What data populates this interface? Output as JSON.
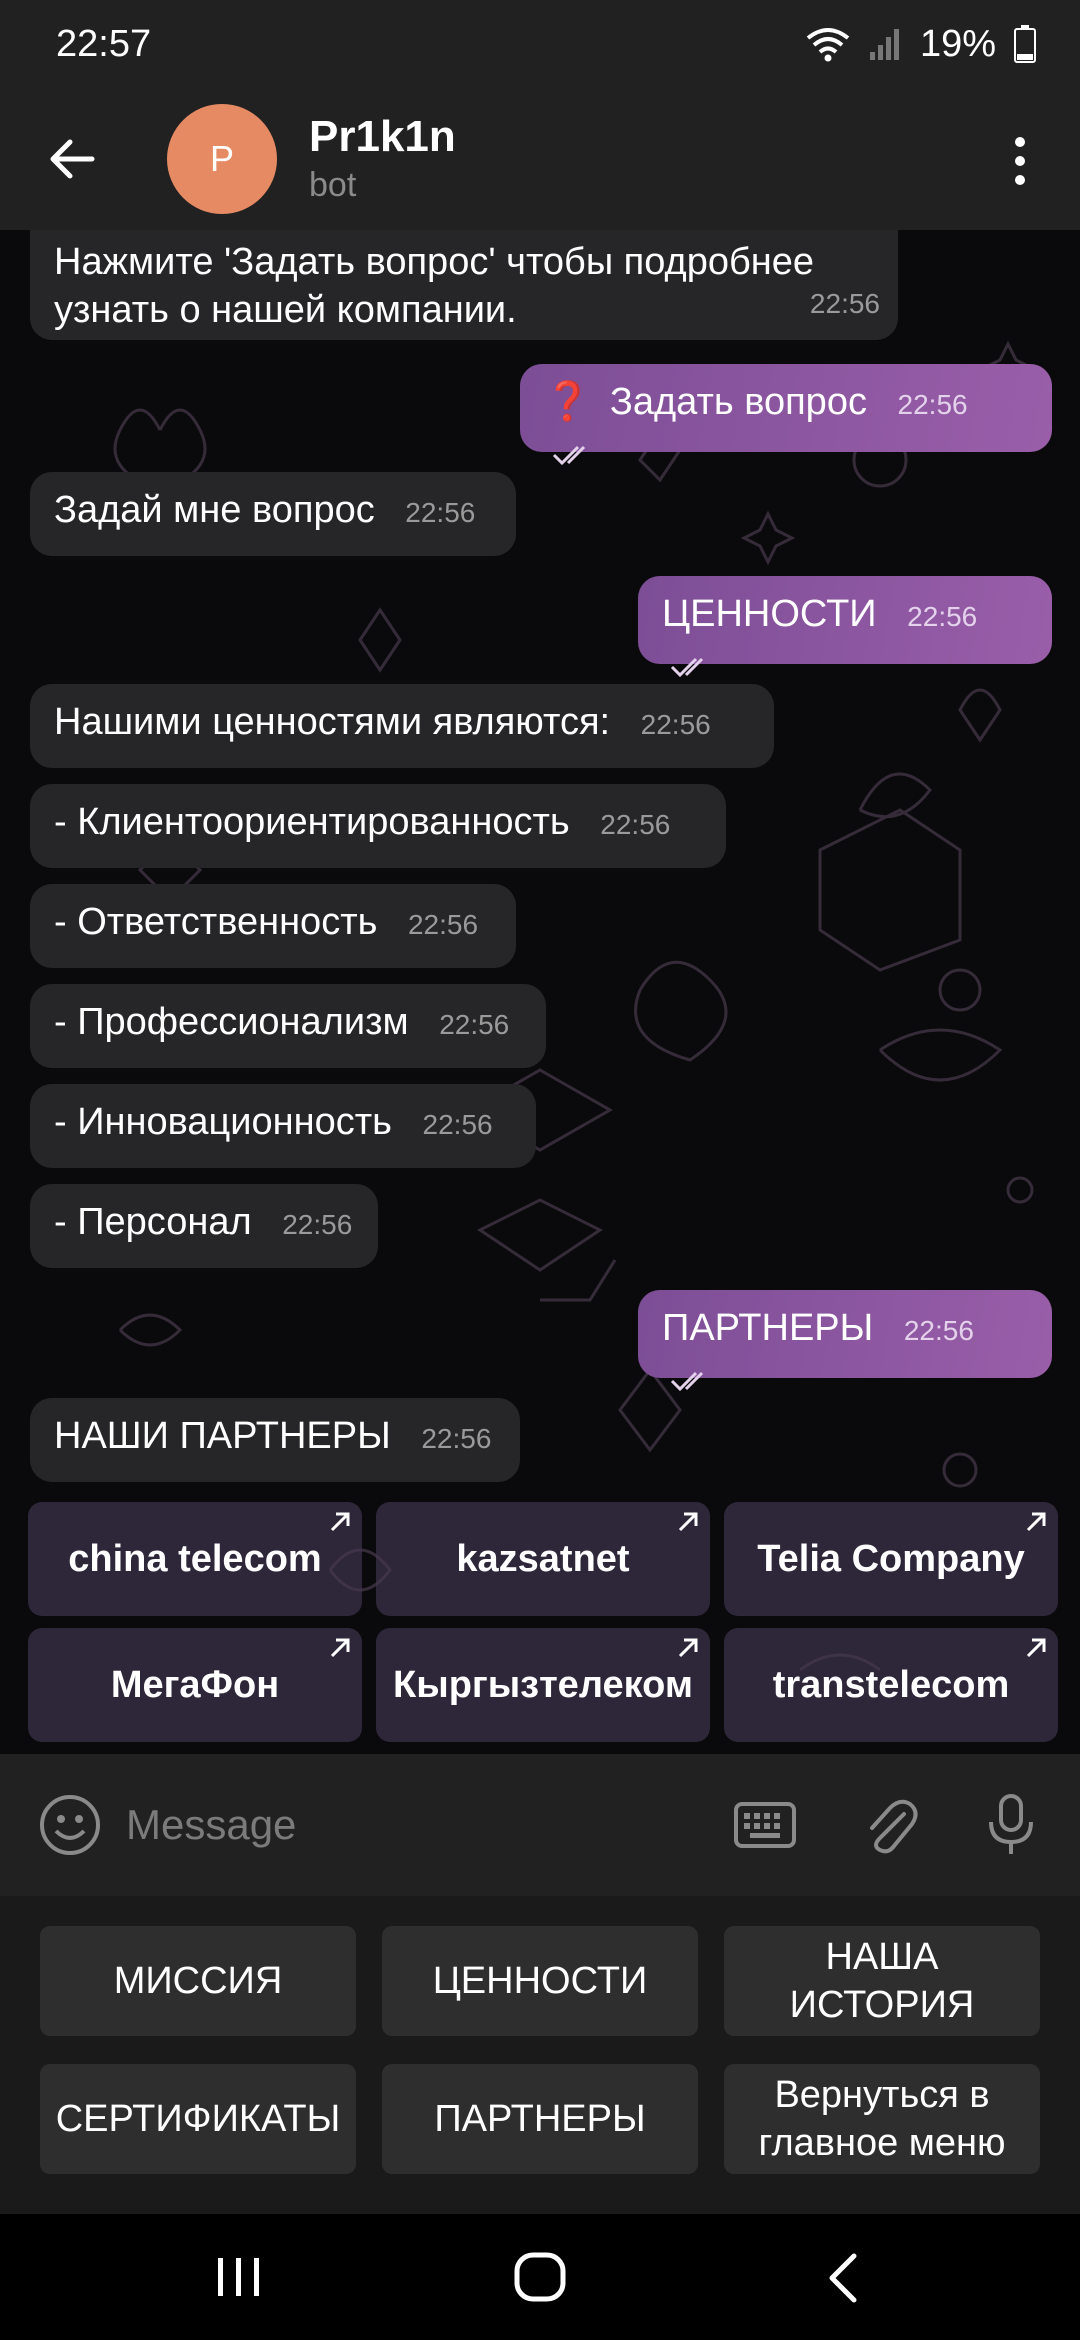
{
  "status": {
    "time": "22:57",
    "battery": "19%"
  },
  "header": {
    "avatar_letter": "P",
    "name": "Pr1k1n",
    "subtitle": "bot"
  },
  "messages": [
    {
      "dir": "in",
      "text": "Нажмите 'Задать вопрос' чтобы подробнее узнать о нашей компании.",
      "time": "22:56"
    },
    {
      "dir": "out",
      "emoji": "❓",
      "text": "Задать вопрос",
      "time": "22:56"
    },
    {
      "dir": "in",
      "text": "Задай мне вопрос",
      "time": "22:56"
    },
    {
      "dir": "out",
      "text": "ЦЕННОСТИ",
      "time": "22:56"
    },
    {
      "dir": "in",
      "text": "Нашими ценностями являются:",
      "time": "22:56"
    },
    {
      "dir": "in",
      "text": "- Клиентоориентированность",
      "time": "22:56"
    },
    {
      "dir": "in",
      "text": "- Ответственность",
      "time": "22:56"
    },
    {
      "dir": "in",
      "text": "- Профессионализм",
      "time": "22:56"
    },
    {
      "dir": "in",
      "text": "- Инновационность",
      "time": "22:56"
    },
    {
      "dir": "in",
      "text": "- Персонал",
      "time": "22:56"
    },
    {
      "dir": "out",
      "text": "ПАРТНЕРЫ",
      "time": "22:56"
    },
    {
      "dir": "in",
      "text": "НАШИ ПАРТНЕРЫ",
      "time": "22:56"
    }
  ],
  "partner_buttons": [
    "china telecom",
    "kazsatnet",
    "Telia Company",
    "МегаФон",
    "Кыргызтелеком",
    "transtelecom"
  ],
  "input": {
    "placeholder": "Message"
  },
  "keyboard": [
    "МИССИЯ",
    "ЦЕННОСТИ",
    "НАША ИСТОРИЯ",
    "СЕРТИФИКАТЫ",
    "ПАРТНЕРЫ",
    "Вернуться в главное меню"
  ],
  "colors": {
    "header_bg": "#212121",
    "incoming_bubble": "#262628",
    "outgoing_bubble": "#8a56a0",
    "avatar": "#e68a64"
  }
}
